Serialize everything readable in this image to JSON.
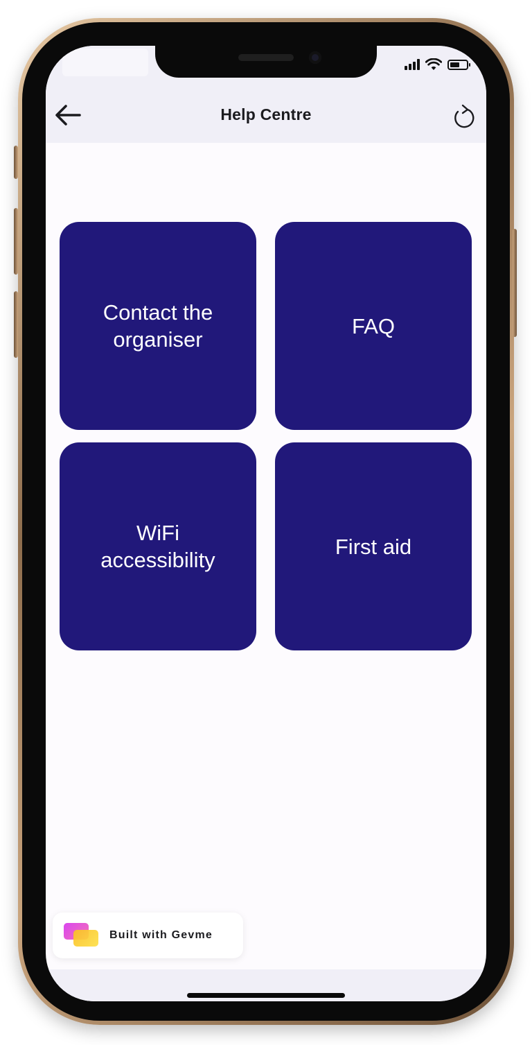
{
  "header": {
    "title": "Help Centre",
    "back_icon": "arrow-left-icon",
    "refresh_icon": "refresh-icon"
  },
  "tiles": [
    {
      "label": "Contact the\norganiser"
    },
    {
      "label": "FAQ"
    },
    {
      "label": "WiFi\naccessibility"
    },
    {
      "label": "First aid"
    }
  ],
  "footer": {
    "badge_label": "Built with Gevme",
    "logo_icon": "gevme-logo-icon"
  },
  "colors": {
    "tile_background": "#21187a",
    "header_background": "#f0eff7",
    "screen_background": "#fdfbfe",
    "tile_text": "#ffffff"
  }
}
